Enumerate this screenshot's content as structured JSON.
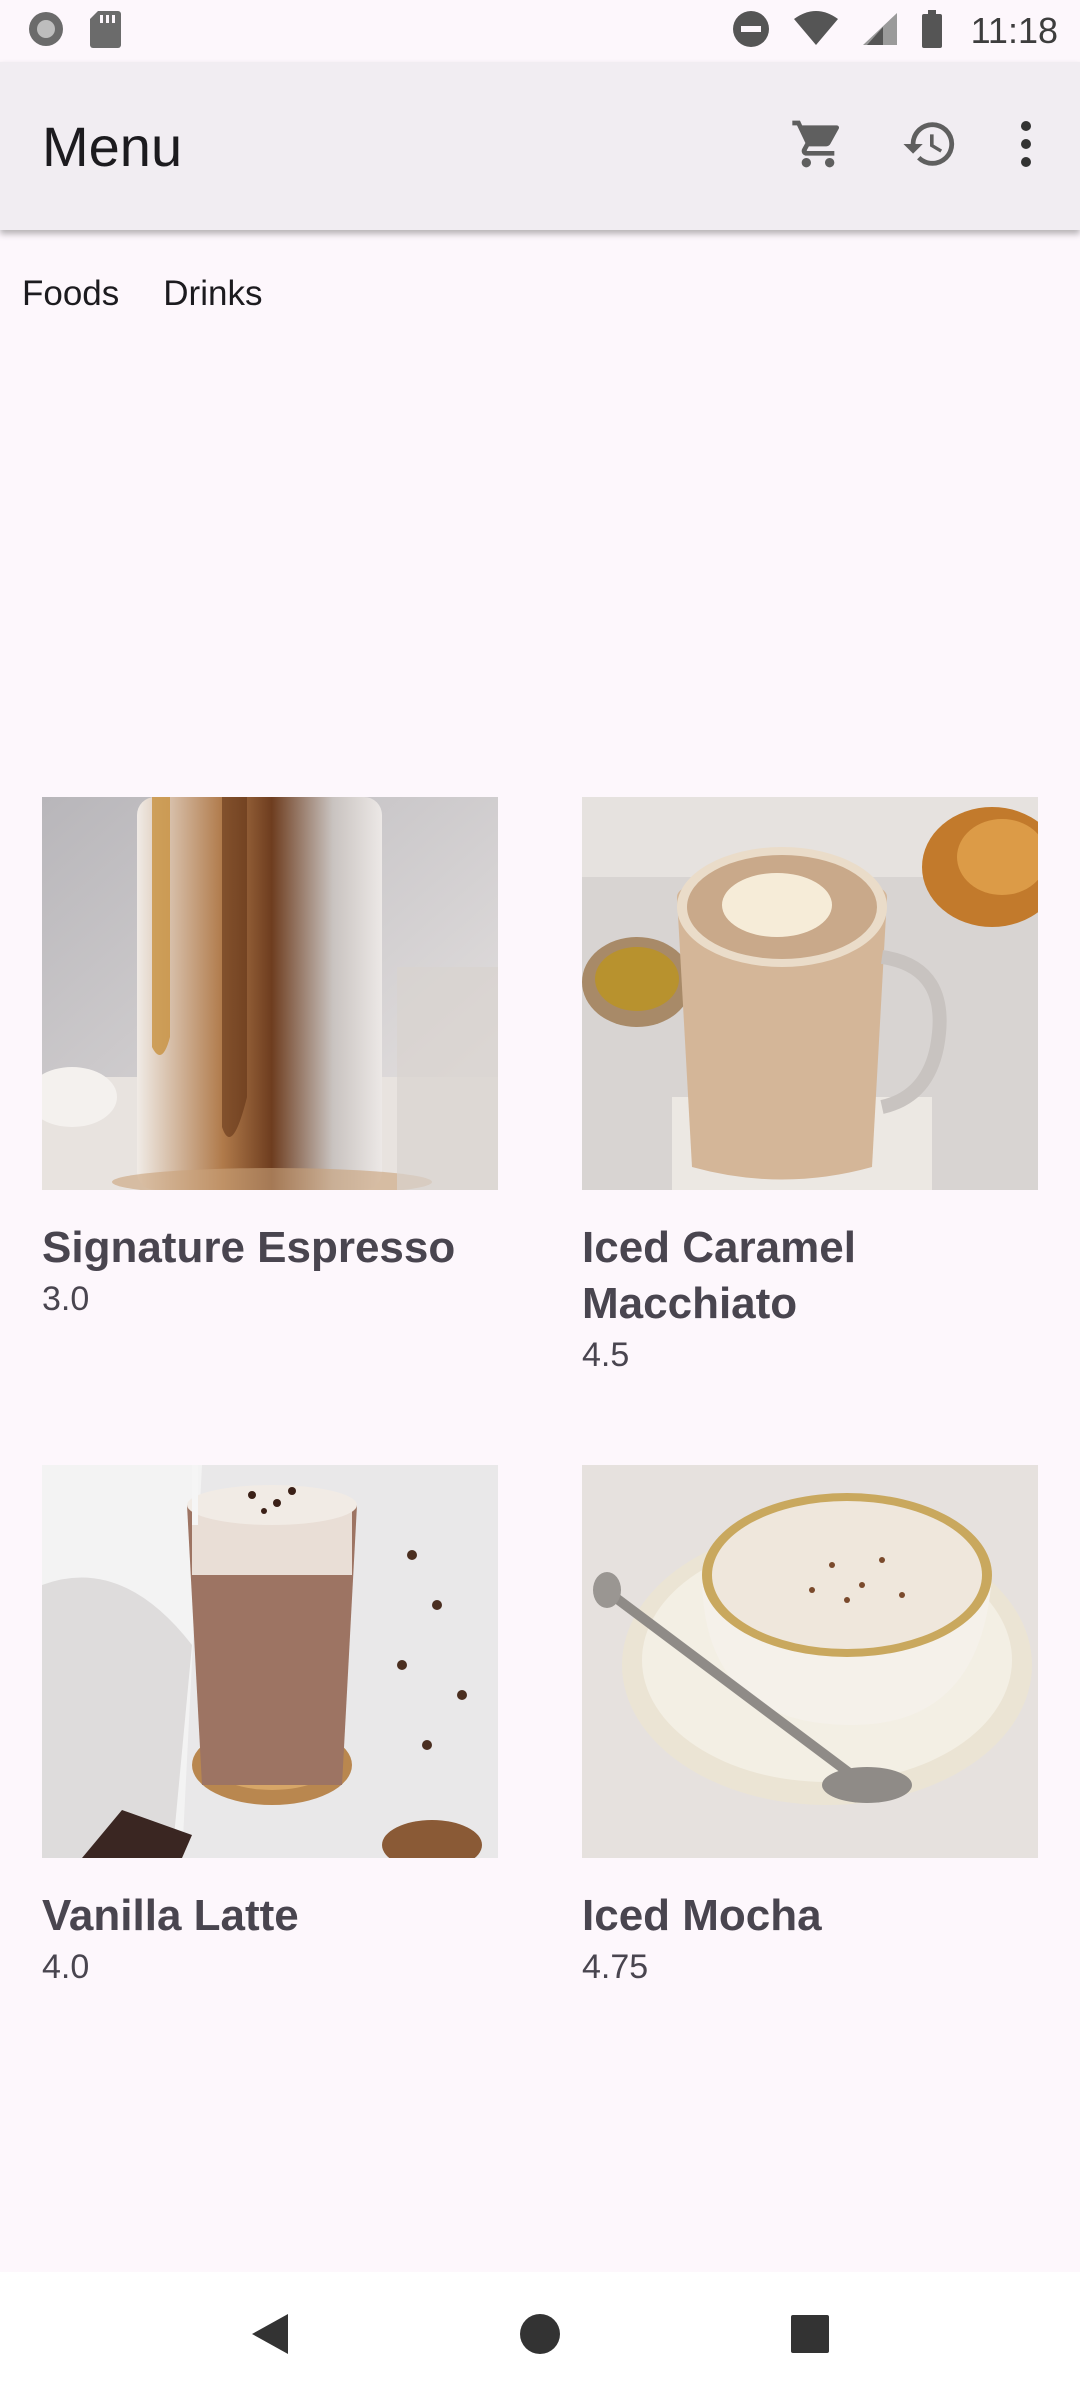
{
  "status_bar": {
    "time": "11:18",
    "icons": [
      "record-icon",
      "sd-card-icon",
      "do-not-disturb-icon",
      "wifi-icon",
      "signal-icon",
      "battery-icon"
    ]
  },
  "app_bar": {
    "title": "Menu",
    "actions": [
      "cart-icon",
      "history-icon",
      "more-vert-icon"
    ]
  },
  "tabs": [
    {
      "label": "Foods"
    },
    {
      "label": "Drinks"
    }
  ],
  "products": [
    {
      "name": "Signature Espresso",
      "price": "3.0"
    },
    {
      "name": "Iced Caramel Macchiato",
      "price": "4.5"
    },
    {
      "name": "Vanilla Latte",
      "price": "4.0"
    },
    {
      "name": "Iced Mocha",
      "price": "4.75"
    }
  ],
  "nav": [
    "back-icon",
    "home-icon",
    "recents-icon"
  ],
  "colors": {
    "background": "#fdf7fc",
    "app_bar": "#f1edf2",
    "text_secondary": "#49454f"
  }
}
